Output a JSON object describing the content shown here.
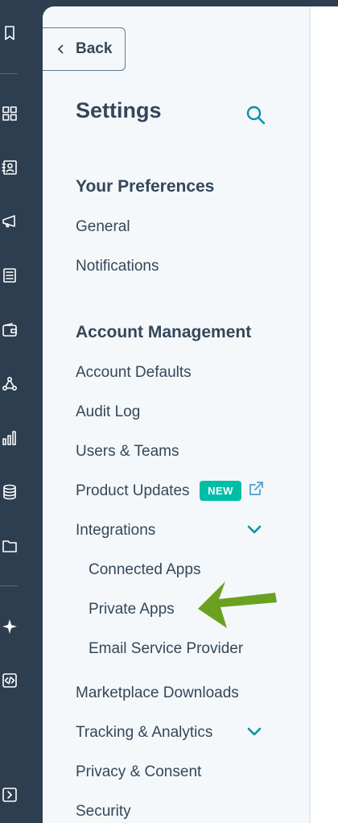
{
  "header": {
    "back_label": "Back",
    "title": "Settings"
  },
  "icons": {
    "rail": [
      "bookmark-icon",
      "grid-icon",
      "contacts-icon",
      "megaphone-icon",
      "document-icon",
      "wallet-icon",
      "network-icon",
      "bar-chart-icon",
      "database-icon",
      "folder-icon",
      "sparkle-icon",
      "code-icon",
      "expand-icon"
    ],
    "search": "search-icon",
    "external": "external-link-icon"
  },
  "colors": {
    "rail_bg": "#2d3e50",
    "panel_bg": "#f5f8fa",
    "text": "#33475b",
    "accent": "#0091ae",
    "badge": "#00bda5",
    "arrow": "#6aa121"
  },
  "nav": {
    "your_preferences": {
      "heading": "Your Preferences",
      "items": [
        "General",
        "Notifications"
      ]
    },
    "account_management": {
      "heading": "Account Management",
      "items": [
        "Account Defaults",
        "Audit Log",
        "Users & Teams",
        "Product Updates",
        "Integrations"
      ],
      "badge_new": "NEW",
      "integrations_sub": [
        "Connected Apps",
        "Private Apps",
        "Email Service Provider"
      ],
      "more_items": [
        "Marketplace Downloads",
        "Tracking & Analytics",
        "Privacy & Consent",
        "Security"
      ]
    }
  }
}
